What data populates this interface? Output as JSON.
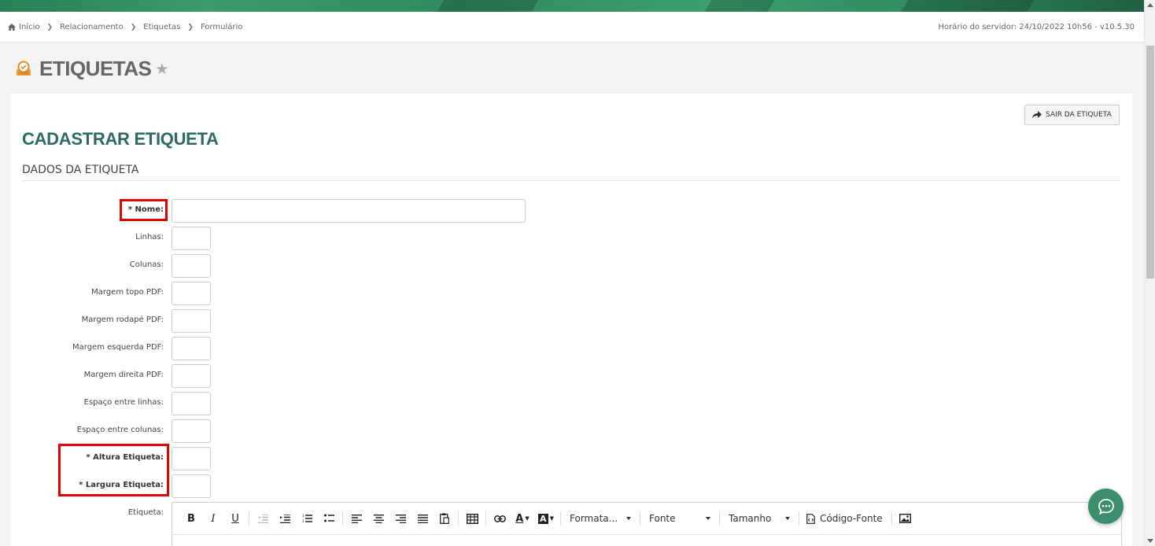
{
  "breadcrumb": {
    "items": [
      "Início",
      "Relacionamento",
      "Etiquetas",
      "Formulário"
    ],
    "server_time": "Horário do servidor: 24/10/2022 10h56 - v10.5.30"
  },
  "page": {
    "title": "ETIQUETAS",
    "exit_button": "SAIR DA ETIQUETA",
    "form_title": "CADASTRAR ETIQUETA",
    "section_title": "DADOS DA ETIQUETA"
  },
  "fields": {
    "nome": {
      "label": "* Nome:",
      "value": ""
    },
    "linhas": {
      "label": "Linhas:",
      "value": ""
    },
    "colunas": {
      "label": "Colunas:",
      "value": ""
    },
    "margem_topo": {
      "label": "Margem topo PDF:",
      "value": ""
    },
    "margem_rodape": {
      "label": "Margem rodapé PDF:",
      "value": ""
    },
    "margem_esquerda": {
      "label": "Margem esquerda PDF:",
      "value": ""
    },
    "margem_direita": {
      "label": "Margem direita PDF:",
      "value": ""
    },
    "espaco_linhas": {
      "label": "Espaço entre linhas:",
      "value": ""
    },
    "espaco_colunas": {
      "label": "Espaço entre colunas:",
      "value": ""
    },
    "altura": {
      "label": "* Altura Etiqueta:",
      "value": ""
    },
    "largura": {
      "label": "* Largura Etiqueta:",
      "value": ""
    },
    "etiqueta": {
      "label": "Etiqueta:"
    }
  },
  "editor": {
    "bold": "B",
    "italic": "I",
    "underline": "U",
    "format_select": "Formata...",
    "font_select": "Fonte",
    "size_select": "Tamanho",
    "source_code": "Código-Fonte",
    "text_color": "A",
    "bg_color": "A"
  },
  "colors": {
    "accent": "#2e6b5e",
    "highlight": "#e00000",
    "chat": "#3a8e6b"
  }
}
